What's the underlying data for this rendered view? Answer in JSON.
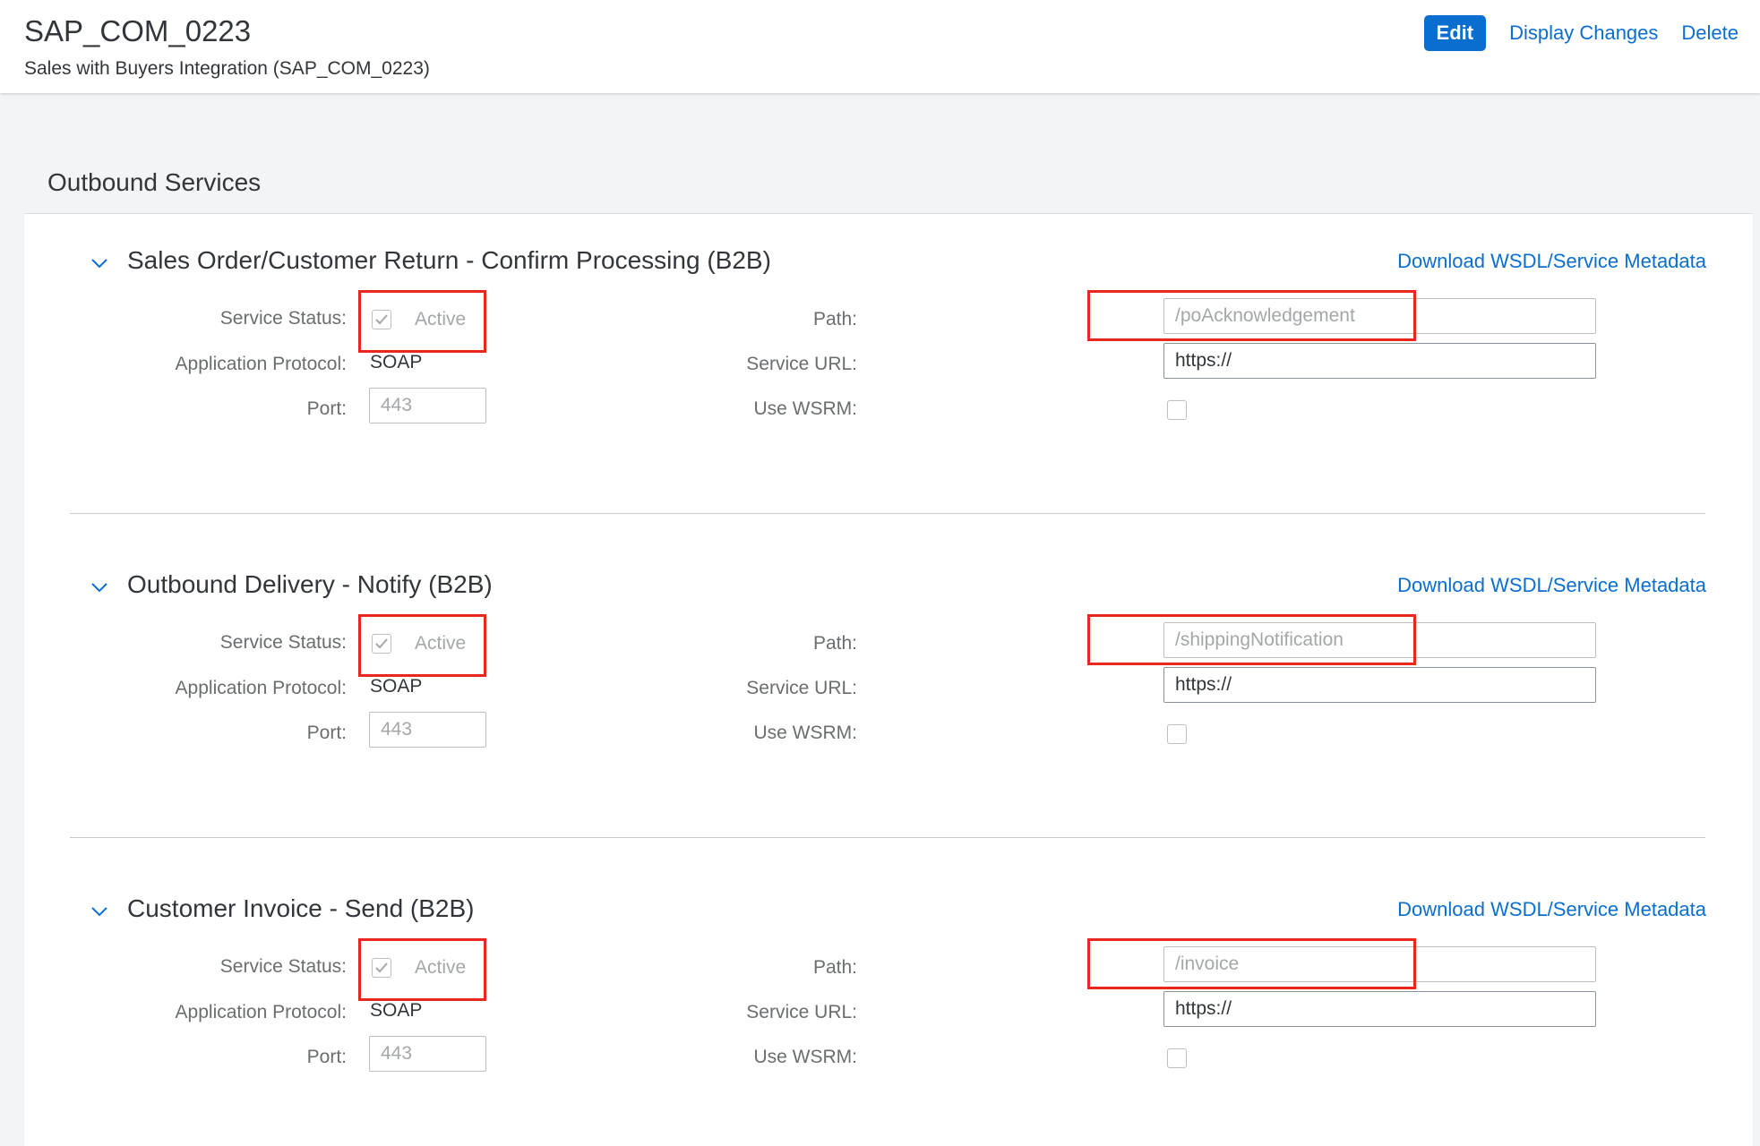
{
  "header": {
    "title": "SAP_COM_0223",
    "subtitle": "Sales with Buyers Integration (SAP_COM_0223)",
    "actions": {
      "edit": "Edit",
      "display_changes": "Display Changes",
      "delete": "Delete"
    }
  },
  "section": {
    "title": "Outbound Services"
  },
  "labels": {
    "service_status": "Service Status:",
    "application_protocol": "Application Protocol:",
    "port": "Port:",
    "path": "Path:",
    "service_url": "Service URL:",
    "use_wsrm": "Use WSRM:",
    "download": "Download WSDL/Service Metadata"
  },
  "colors": {
    "accent": "#0a6ed1",
    "highlight": "#e8281e"
  },
  "services": [
    {
      "title": "Sales Order/Customer Return - Confirm Processing (B2B)",
      "status": "Active",
      "status_checked": true,
      "protocol": "SOAP",
      "port": "443",
      "path": "/poAcknowledgement",
      "service_url": "https://",
      "use_wsrm": false
    },
    {
      "title": "Outbound Delivery - Notify (B2B)",
      "status": "Active",
      "status_checked": true,
      "protocol": "SOAP",
      "port": "443",
      "path": "/shippingNotification",
      "service_url": "https://",
      "use_wsrm": false
    },
    {
      "title": "Customer Invoice - Send (B2B)",
      "status": "Active",
      "status_checked": true,
      "protocol": "SOAP",
      "port": "443",
      "path": "/invoice",
      "service_url": "https://",
      "use_wsrm": false
    }
  ]
}
